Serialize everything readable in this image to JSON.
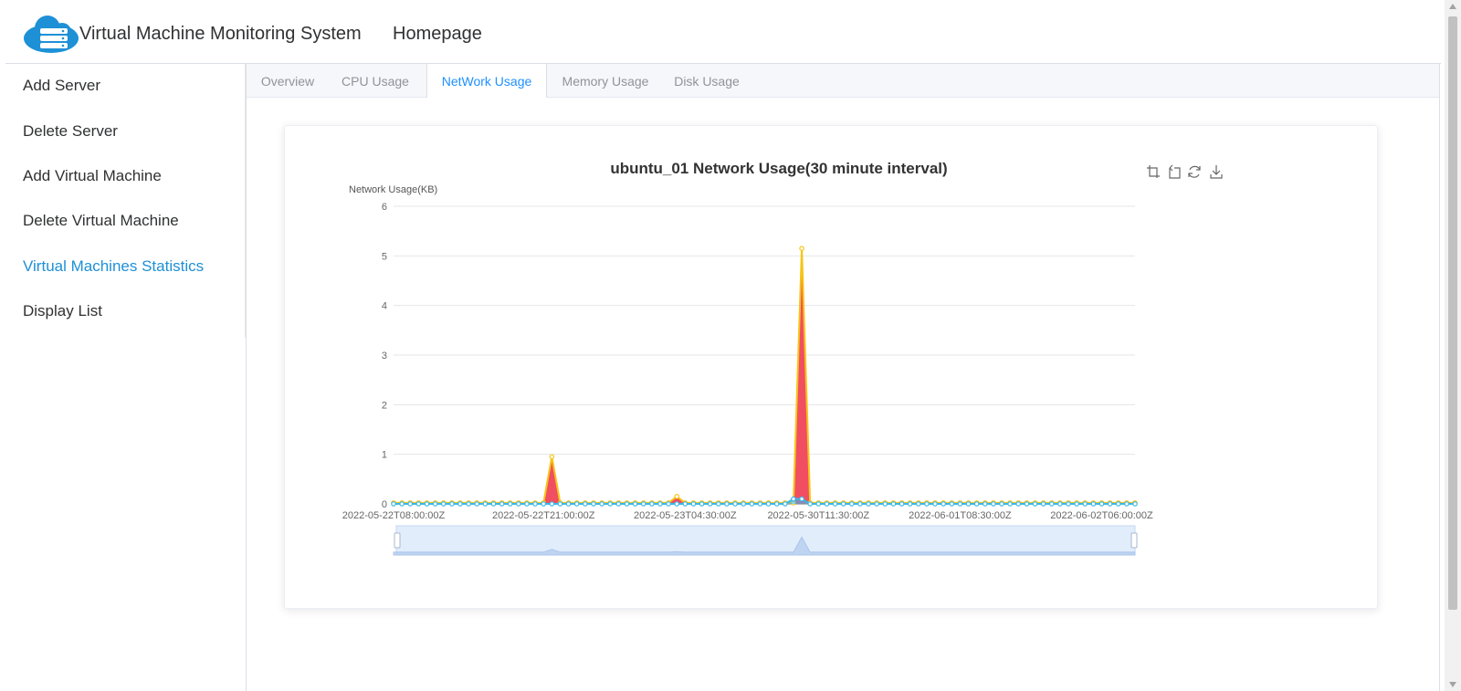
{
  "header": {
    "app_title": "Virtual Machine Monitoring System",
    "home_label": "Homepage",
    "logo_icon": "cloud-server-icon",
    "accent_color": "#1e90d6"
  },
  "sidebar": {
    "items": [
      {
        "label": "Add Server",
        "active": false
      },
      {
        "label": "Delete Server",
        "active": false
      },
      {
        "label": "Add Virtual Machine",
        "active": false
      },
      {
        "label": "Delete Virtual Machine",
        "active": false
      },
      {
        "label": "Virtual Machines Statistics",
        "active": true
      },
      {
        "label": "Display List",
        "active": false
      }
    ]
  },
  "tabs": [
    {
      "label": "Overview",
      "active": false
    },
    {
      "label": "CPU Usage",
      "active": false
    },
    {
      "label": "NetWork Usage",
      "active": true
    },
    {
      "label": "Memory Usage",
      "active": false
    },
    {
      "label": "Disk Usage",
      "active": false
    }
  ],
  "toolbox": {
    "icons": [
      "zoom-icon",
      "zoom-reset-icon",
      "restore-icon",
      "download-icon"
    ]
  },
  "chart_data": {
    "type": "area",
    "title": "ubuntu_01 Network Usage(30 minute interval)",
    "ylabel": "Network Usage(KB)",
    "xlabel": "",
    "ylim": [
      0,
      6
    ],
    "yticks": [
      "0",
      "1",
      "2",
      "3",
      "4",
      "5",
      "6"
    ],
    "xtick_labels": [
      "2022-05-22T08:00:00Z",
      "2022-05-22T21:00:00Z",
      "2022-05-23T04:30:00Z",
      "2022-05-30T11:30:00Z",
      "2022-06-01T08:30:00Z",
      "2022-06-02T06:00:00Z"
    ],
    "grid": true,
    "legend": "none",
    "point_count": 90,
    "series": [
      {
        "color": "#f5c518",
        "fill": "#f0445a",
        "points": [
          [
            0,
            0.02
          ],
          [
            18,
            0.02
          ],
          [
            19,
            0.95
          ],
          [
            20,
            0.02
          ],
          [
            33,
            0.02
          ],
          [
            34,
            0.15
          ],
          [
            35,
            0.02
          ],
          [
            48,
            0.02
          ],
          [
            49,
            5.15
          ],
          [
            50,
            0.02
          ],
          [
            89,
            0.02
          ]
        ]
      },
      {
        "color": "#3ab7e8",
        "fill": "#3ab7e8",
        "points": [
          [
            0,
            0.0
          ],
          [
            47,
            0.0
          ],
          [
            48,
            0.1
          ],
          [
            49,
            0.1
          ],
          [
            50,
            0.0
          ],
          [
            89,
            0.0
          ]
        ]
      }
    ],
    "slider_color": "#d6e6fb"
  }
}
